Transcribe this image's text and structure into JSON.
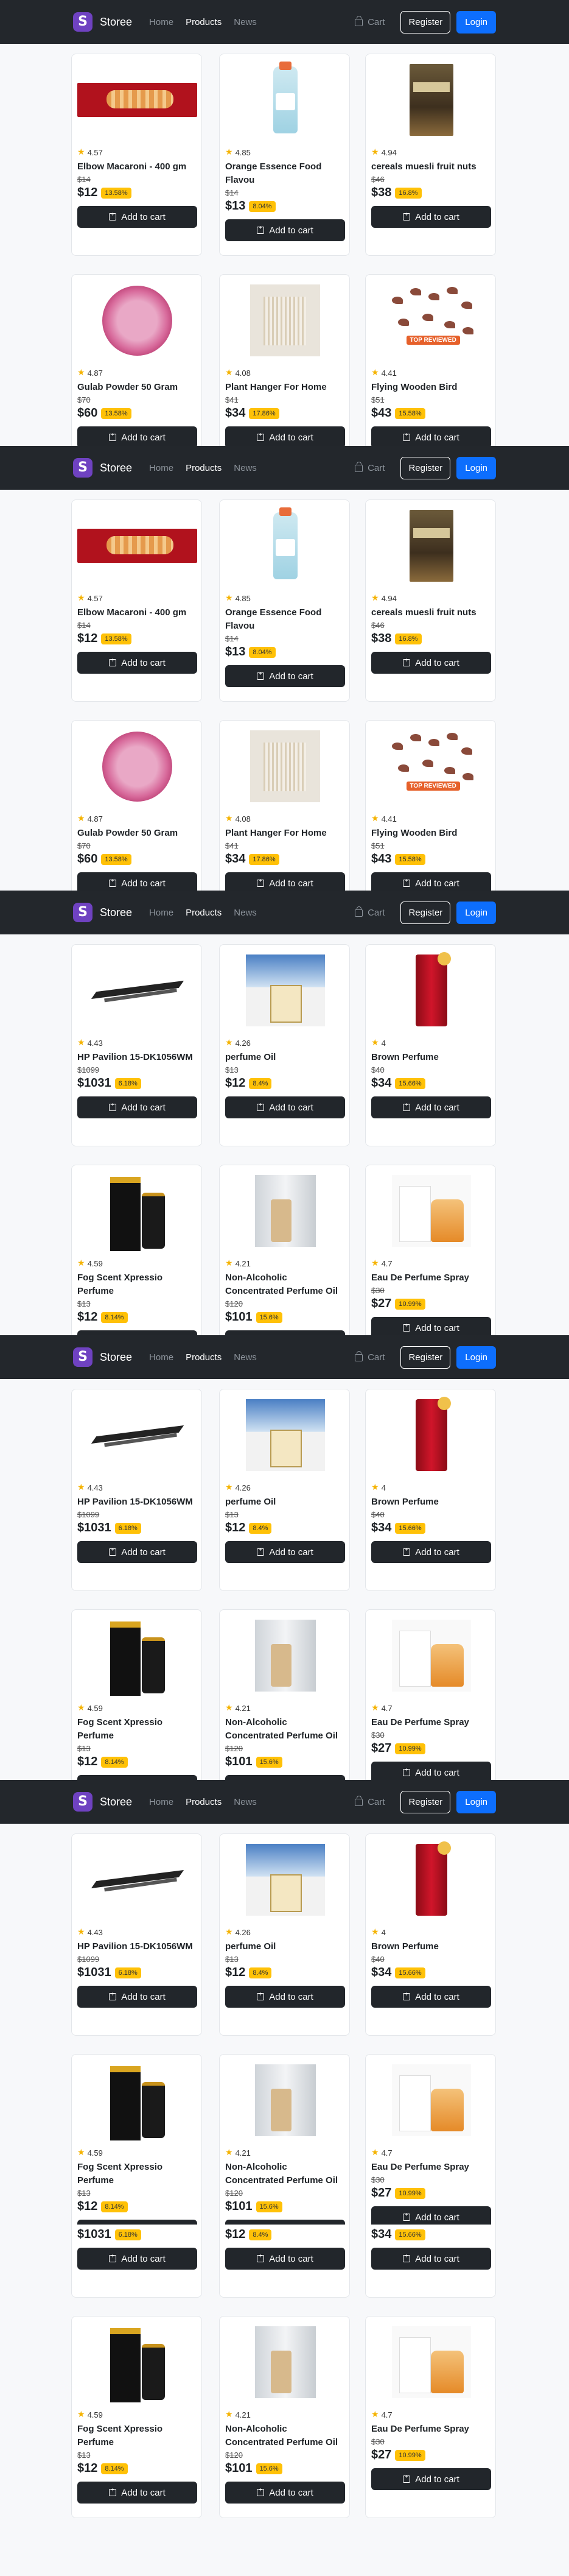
{
  "nav": {
    "logo_letter": "S",
    "brand": "Storee",
    "links": [
      "Home",
      "Products",
      "News"
    ],
    "active_link": "Products",
    "cart": "Cart",
    "register": "Register",
    "login": "Login"
  },
  "add_to_cart_label": "Add to cart",
  "catalog_a": [
    {
      "icon": "pasta-image",
      "rating": "4.57",
      "title": "Elbow Macaroni - 400 gm",
      "old_price": "$14",
      "price": "$12",
      "discount": "13.58%"
    },
    {
      "icon": "bottle-image",
      "rating": "4.85",
      "title": "Orange Essence Food Flavou",
      "old_price": "$14",
      "price": "$13",
      "discount": "8.04%"
    },
    {
      "icon": "muesli-image",
      "rating": "4.94",
      "title": "cereals muesli fruit nuts",
      "old_price": "$46",
      "price": "$38",
      "discount": "16.8%"
    },
    {
      "icon": "powder-image",
      "rating": "4.87",
      "title": "Gulab Powder 50 Gram",
      "old_price": "$70",
      "price": "$60",
      "discount": "13.58%"
    },
    {
      "icon": "hanger-image",
      "rating": "4.08",
      "title": "Plant Hanger For Home",
      "old_price": "$41",
      "price": "$34",
      "discount": "17.86%"
    },
    {
      "icon": "birds-image",
      "rating": "4.41",
      "title": "Flying Wooden Bird",
      "old_price": "$51",
      "price": "$43",
      "discount": "15.58%"
    }
  ],
  "catalog_b": [
    {
      "icon": "laptop-image",
      "rating": "4.43",
      "title": "HP Pavilion 15-DK1056WM",
      "old_price": "$1099",
      "price": "$1031",
      "discount": "6.18%"
    },
    {
      "icon": "edp-image",
      "rating": "4.26",
      "title": "perfume Oil",
      "old_price": "$13",
      "price": "$12",
      "discount": "8.4%"
    },
    {
      "icon": "red-perfume-image",
      "rating": "4",
      "title": "Brown Perfume",
      "old_price": "$40",
      "price": "$34",
      "discount": "15.66%"
    },
    {
      "icon": "fogg-image",
      "rating": "4.59",
      "title": "Fog Scent Xpressio Perfume",
      "old_price": "$13",
      "price": "$12",
      "discount": "8.14%"
    },
    {
      "icon": "nonalc-image",
      "rating": "4.21",
      "title": "Non-Alcoholic Concentrated Perfume Oil",
      "old_price": "$120",
      "price": "$101",
      "discount": "15.6%"
    },
    {
      "icon": "eau-image",
      "rating": "4.7",
      "title": "Eau De Perfume Spray",
      "old_price": "$30",
      "price": "$27",
      "discount": "10.99%"
    }
  ],
  "trophy_badge": "TOP REVIEWED",
  "colors": {
    "navbar": "#23272c",
    "accent": "#0d6efd",
    "badge": "#ffc107",
    "logo": "#6f42c1"
  }
}
